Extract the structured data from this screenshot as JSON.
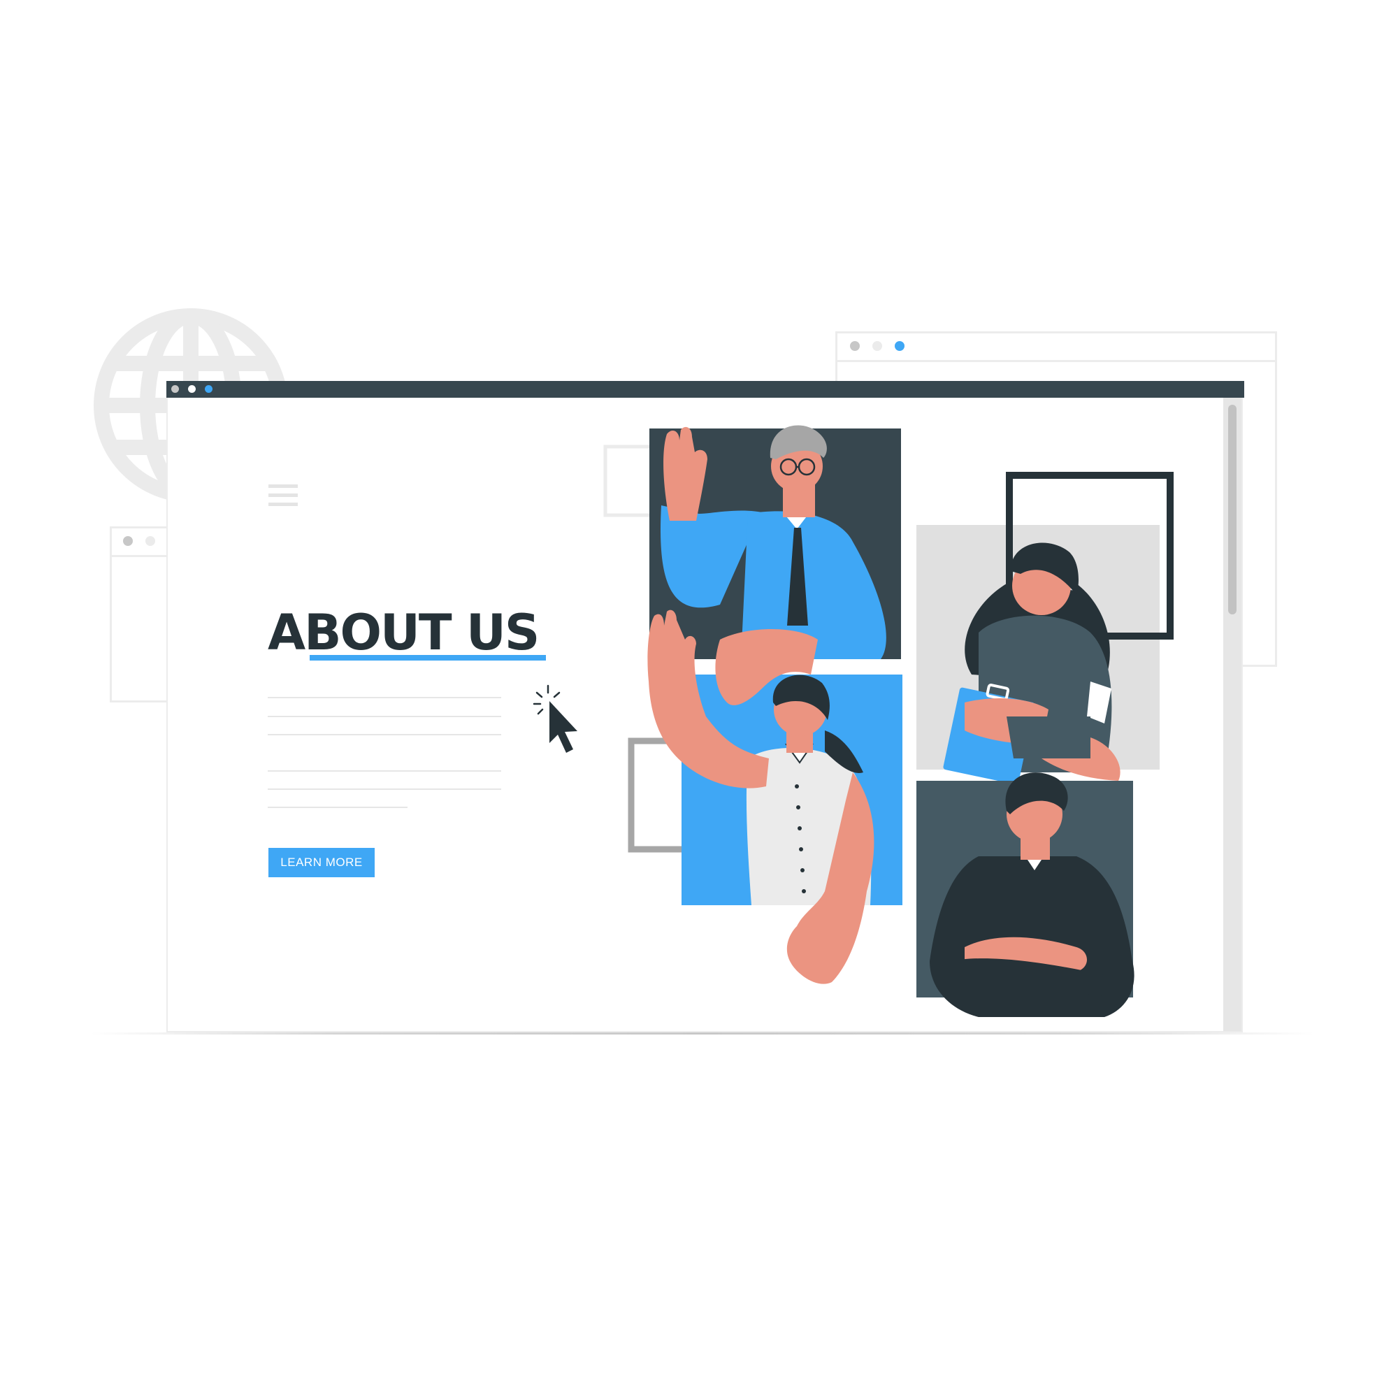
{
  "colors": {
    "accent": "#3fa7f5",
    "dark": "#263238",
    "titlebar": "#37474f",
    "slate": "#455a64",
    "skin": "#eb9481",
    "light_gray": "#e0e0e0"
  },
  "main": {
    "heading": "ABOUT US",
    "cta_label": "LEARN MORE"
  },
  "icons": [
    "globe-icon",
    "hamburger-menu-icon",
    "cursor-pointer-icon"
  ]
}
